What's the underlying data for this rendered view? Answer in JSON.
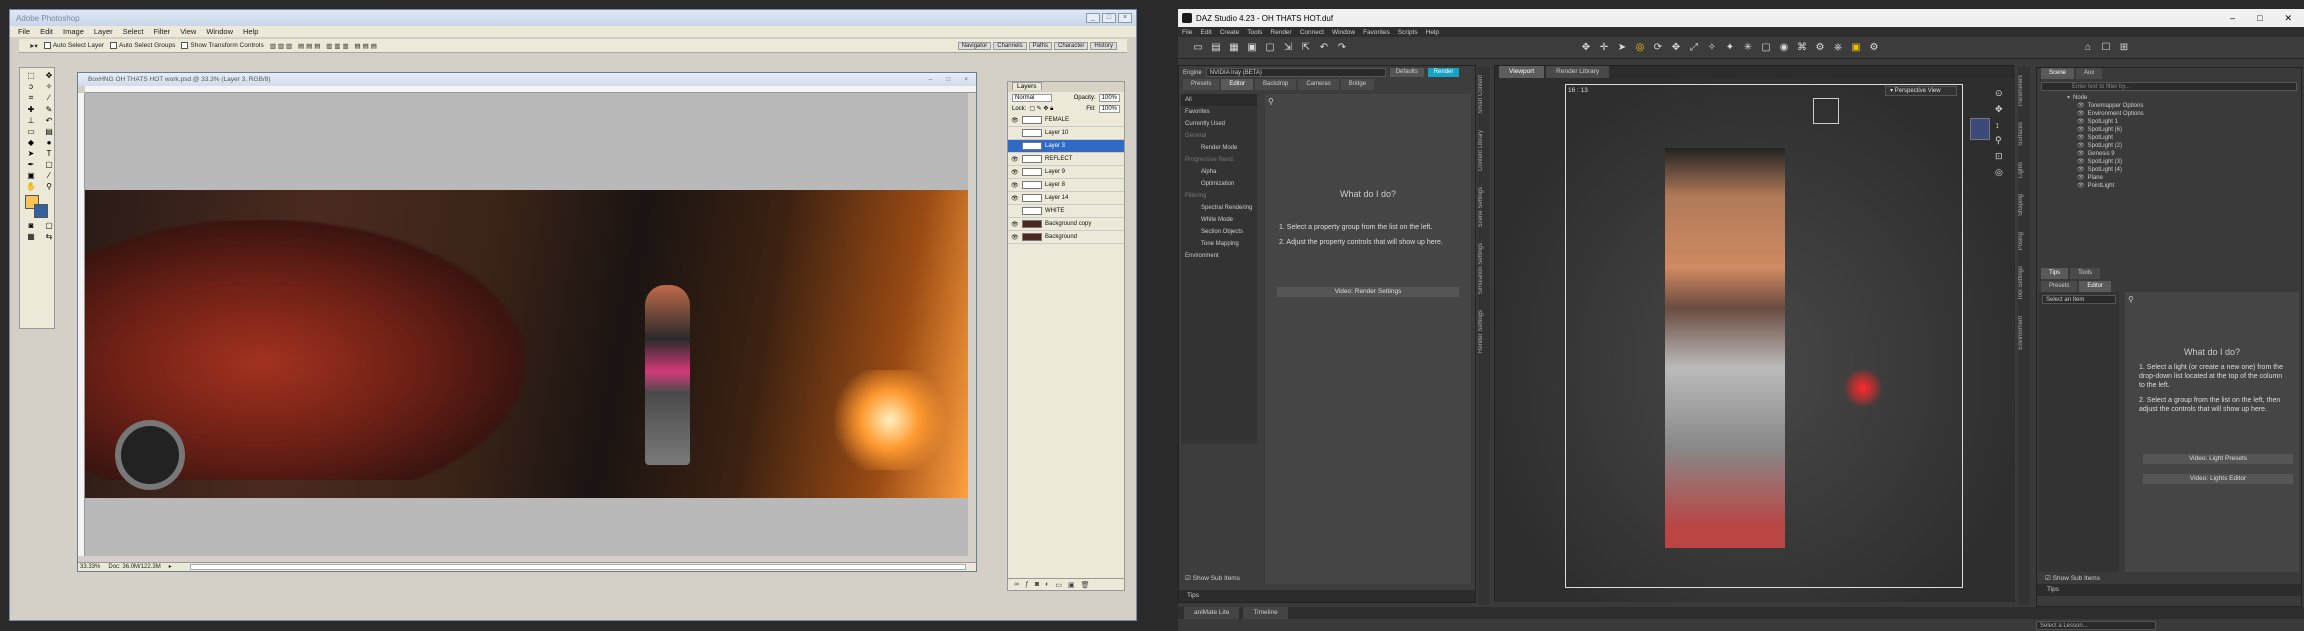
{
  "photoshop": {
    "title": "Adobe Photoshop",
    "menu": [
      "File",
      "Edit",
      "Image",
      "Layer",
      "Select",
      "Filter",
      "View",
      "Window",
      "Help"
    ],
    "options": {
      "auto_select_layer": "Auto Select Layer",
      "auto_select_groups": "Auto Select Groups",
      "show_transform": "Show Transform Controls"
    },
    "dock_tabs": [
      "Navigator",
      "Channels",
      "Paths",
      "Character",
      "History"
    ],
    "document": {
      "title": "BoxHNG OH THATS HOT work.psd @ 33.3% (Layer 3, RGB/8)",
      "zoom": "33.33%",
      "doc_size": "Doc: 36.0M/122.3M"
    },
    "layers_panel": {
      "tab": "Layers",
      "blend": "Normal",
      "opacity_label": "Opacity:",
      "opacity": "100%",
      "lock_label": "Lock:",
      "fill_label": "Fill:",
      "fill": "100%",
      "layers": [
        {
          "name": "FEMALE",
          "visible": true,
          "selected": false
        },
        {
          "name": "Layer 10",
          "visible": false,
          "selected": false
        },
        {
          "name": "Layer 3",
          "visible": false,
          "selected": true
        },
        {
          "name": "REFLECT",
          "visible": true,
          "selected": false
        },
        {
          "name": "Layer 9",
          "visible": true,
          "selected": false
        },
        {
          "name": "Layer 8",
          "visible": true,
          "selected": false
        },
        {
          "name": "Layer 14",
          "visible": true,
          "selected": false
        },
        {
          "name": "WHITE",
          "visible": false,
          "selected": false
        },
        {
          "name": "Background copy",
          "visible": true,
          "selected": false
        },
        {
          "name": "Background",
          "visible": true,
          "selected": false
        }
      ]
    }
  },
  "daz": {
    "title": "DAZ Studio 4.23 - OH THATS HOT.duf",
    "menu": [
      "File",
      "Edit",
      "Create",
      "Tools",
      "Render",
      "Connect",
      "Window",
      "Favorites",
      "Scripts",
      "Help"
    ],
    "render": {
      "engine_label": "Engine",
      "engine": "NVIDIA Iray (BETA)",
      "defaults": "Defaults",
      "render_btn": "Render",
      "tabs": [
        "Presets",
        "Editor",
        "Backdrop",
        "Cameras",
        "Bridge"
      ],
      "groups": [
        {
          "label": "All",
          "sub": false,
          "dim": false,
          "sel": true
        },
        {
          "label": "Favorites",
          "sub": false,
          "dim": false,
          "sel": false
        },
        {
          "label": "Currently Used",
          "sub": false,
          "dim": false,
          "sel": false
        },
        {
          "label": "General",
          "sub": false,
          "dim": true,
          "sel": false
        },
        {
          "label": "Render Mode",
          "sub": true,
          "dim": false,
          "sel": false
        },
        {
          "label": "Progressive Rend.",
          "sub": false,
          "dim": true,
          "sel": false
        },
        {
          "label": "Alpha",
          "sub": true,
          "dim": false,
          "sel": false
        },
        {
          "label": "Optimization",
          "sub": true,
          "dim": false,
          "sel": false
        },
        {
          "label": "Filtering",
          "sub": false,
          "dim": true,
          "sel": false
        },
        {
          "label": "Spectral Rendering",
          "sub": true,
          "dim": false,
          "sel": false
        },
        {
          "label": "White Mode",
          "sub": true,
          "dim": false,
          "sel": false
        },
        {
          "label": "Section Objects",
          "sub": true,
          "dim": false,
          "sel": false
        },
        {
          "label": "Tone Mapping",
          "sub": true,
          "dim": false,
          "sel": false
        },
        {
          "label": "Environment",
          "sub": false,
          "dim": false,
          "sel": false
        }
      ],
      "help_title": "What do I do?",
      "help_1": "1. Select a property group from the list on the left.",
      "help_2": "2. Adjust the property controls that will show up here.",
      "video_btn": "Video: Render Settings",
      "show_sub": "Show Sub Items",
      "tips": "Tips"
    },
    "left_vtabs": [
      "Smart Content",
      "Content Library",
      "Scene Settings",
      "Simulation Settings",
      "Render Settings"
    ],
    "viewport": {
      "tabs": [
        "Viewport",
        "Render Library"
      ],
      "camera_ratio": "16 : 13",
      "view": "Perspective View"
    },
    "scene": {
      "tabs": [
        "Scene",
        "Aux"
      ],
      "search": "Enter text to filter by...",
      "header": "Node",
      "nodes": [
        {
          "label": "Tonemapper Options",
          "lv": 1
        },
        {
          "label": "Environment Options",
          "lv": 1
        },
        {
          "label": "SpotLight 1",
          "lv": 1
        },
        {
          "label": "SpotLight (6)",
          "lv": 1
        },
        {
          "label": "SpotLight",
          "lv": 1
        },
        {
          "label": "SpotLight (2)",
          "lv": 1
        },
        {
          "label": "Genesis 9",
          "lv": 1
        },
        {
          "label": "SpotLight (3)",
          "lv": 1
        },
        {
          "label": "SpotLight (4)",
          "lv": 1
        },
        {
          "label": "Plane",
          "lv": 1
        },
        {
          "label": "PointLight",
          "lv": 1
        }
      ]
    },
    "lights": {
      "tabs_top": [
        "Tips",
        "Tools"
      ],
      "tabs": [
        "Presets",
        "Editor"
      ],
      "select": "Select an Item",
      "help_title": "What do I do?",
      "help_1": "1. Select a light (or create a new one) from the drop-down list located at the top of the column to the left.",
      "help_2": "2. Select a group from the list on the left, then adjust the controls that will show up here.",
      "video1": "Video: Light Presets",
      "video2": "Video: Lights Editor",
      "show_sub": "Show Sub Items",
      "tips": "Tips"
    },
    "right_vtabs": [
      "Parameters",
      "Surfaces",
      "Lights",
      "Shaping",
      "Posing",
      "Tool Settings",
      "Environment"
    ],
    "bottom_tabs": [
      "aniMate Lite",
      "Timeline"
    ],
    "lesson": "Select a Lesson..."
  }
}
